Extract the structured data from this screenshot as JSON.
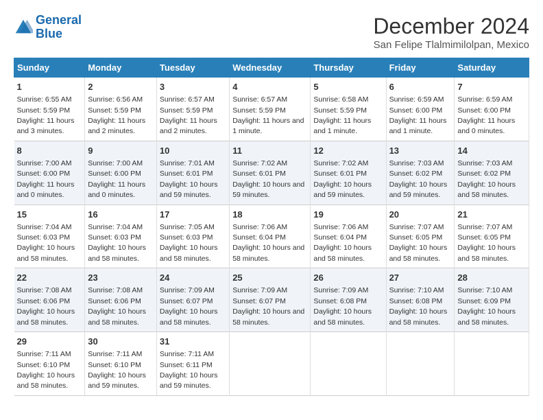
{
  "logo": {
    "line1": "General",
    "line2": "Blue"
  },
  "title": "December 2024",
  "subtitle": "San Felipe Tlalmimilolpan, Mexico",
  "days_of_week": [
    "Sunday",
    "Monday",
    "Tuesday",
    "Wednesday",
    "Thursday",
    "Friday",
    "Saturday"
  ],
  "weeks": [
    [
      {
        "day": "1",
        "sunrise": "6:55 AM",
        "sunset": "5:59 PM",
        "daylight": "11 hours and 3 minutes."
      },
      {
        "day": "2",
        "sunrise": "6:56 AM",
        "sunset": "5:59 PM",
        "daylight": "11 hours and 2 minutes."
      },
      {
        "day": "3",
        "sunrise": "6:57 AM",
        "sunset": "5:59 PM",
        "daylight": "11 hours and 2 minutes."
      },
      {
        "day": "4",
        "sunrise": "6:57 AM",
        "sunset": "5:59 PM",
        "daylight": "11 hours and 1 minute."
      },
      {
        "day": "5",
        "sunrise": "6:58 AM",
        "sunset": "5:59 PM",
        "daylight": "11 hours and 1 minute."
      },
      {
        "day": "6",
        "sunrise": "6:59 AM",
        "sunset": "6:00 PM",
        "daylight": "11 hours and 1 minute."
      },
      {
        "day": "7",
        "sunrise": "6:59 AM",
        "sunset": "6:00 PM",
        "daylight": "11 hours and 0 minutes."
      }
    ],
    [
      {
        "day": "8",
        "sunrise": "7:00 AM",
        "sunset": "6:00 PM",
        "daylight": "11 hours and 0 minutes."
      },
      {
        "day": "9",
        "sunrise": "7:00 AM",
        "sunset": "6:00 PM",
        "daylight": "11 hours and 0 minutes."
      },
      {
        "day": "10",
        "sunrise": "7:01 AM",
        "sunset": "6:01 PM",
        "daylight": "10 hours and 59 minutes."
      },
      {
        "day": "11",
        "sunrise": "7:02 AM",
        "sunset": "6:01 PM",
        "daylight": "10 hours and 59 minutes."
      },
      {
        "day": "12",
        "sunrise": "7:02 AM",
        "sunset": "6:01 PM",
        "daylight": "10 hours and 59 minutes."
      },
      {
        "day": "13",
        "sunrise": "7:03 AM",
        "sunset": "6:02 PM",
        "daylight": "10 hours and 59 minutes."
      },
      {
        "day": "14",
        "sunrise": "7:03 AM",
        "sunset": "6:02 PM",
        "daylight": "10 hours and 58 minutes."
      }
    ],
    [
      {
        "day": "15",
        "sunrise": "7:04 AM",
        "sunset": "6:03 PM",
        "daylight": "10 hours and 58 minutes."
      },
      {
        "day": "16",
        "sunrise": "7:04 AM",
        "sunset": "6:03 PM",
        "daylight": "10 hours and 58 minutes."
      },
      {
        "day": "17",
        "sunrise": "7:05 AM",
        "sunset": "6:03 PM",
        "daylight": "10 hours and 58 minutes."
      },
      {
        "day": "18",
        "sunrise": "7:06 AM",
        "sunset": "6:04 PM",
        "daylight": "10 hours and 58 minutes."
      },
      {
        "day": "19",
        "sunrise": "7:06 AM",
        "sunset": "6:04 PM",
        "daylight": "10 hours and 58 minutes."
      },
      {
        "day": "20",
        "sunrise": "7:07 AM",
        "sunset": "6:05 PM",
        "daylight": "10 hours and 58 minutes."
      },
      {
        "day": "21",
        "sunrise": "7:07 AM",
        "sunset": "6:05 PM",
        "daylight": "10 hours and 58 minutes."
      }
    ],
    [
      {
        "day": "22",
        "sunrise": "7:08 AM",
        "sunset": "6:06 PM",
        "daylight": "10 hours and 58 minutes."
      },
      {
        "day": "23",
        "sunrise": "7:08 AM",
        "sunset": "6:06 PM",
        "daylight": "10 hours and 58 minutes."
      },
      {
        "day": "24",
        "sunrise": "7:09 AM",
        "sunset": "6:07 PM",
        "daylight": "10 hours and 58 minutes."
      },
      {
        "day": "25",
        "sunrise": "7:09 AM",
        "sunset": "6:07 PM",
        "daylight": "10 hours and 58 minutes."
      },
      {
        "day": "26",
        "sunrise": "7:09 AM",
        "sunset": "6:08 PM",
        "daylight": "10 hours and 58 minutes."
      },
      {
        "day": "27",
        "sunrise": "7:10 AM",
        "sunset": "6:08 PM",
        "daylight": "10 hours and 58 minutes."
      },
      {
        "day": "28",
        "sunrise": "7:10 AM",
        "sunset": "6:09 PM",
        "daylight": "10 hours and 58 minutes."
      }
    ],
    [
      {
        "day": "29",
        "sunrise": "7:11 AM",
        "sunset": "6:10 PM",
        "daylight": "10 hours and 58 minutes."
      },
      {
        "day": "30",
        "sunrise": "7:11 AM",
        "sunset": "6:10 PM",
        "daylight": "10 hours and 59 minutes."
      },
      {
        "day": "31",
        "sunrise": "7:11 AM",
        "sunset": "6:11 PM",
        "daylight": "10 hours and 59 minutes."
      },
      null,
      null,
      null,
      null
    ]
  ],
  "labels": {
    "sunrise": "Sunrise:",
    "sunset": "Sunset:",
    "daylight": "Daylight:"
  }
}
